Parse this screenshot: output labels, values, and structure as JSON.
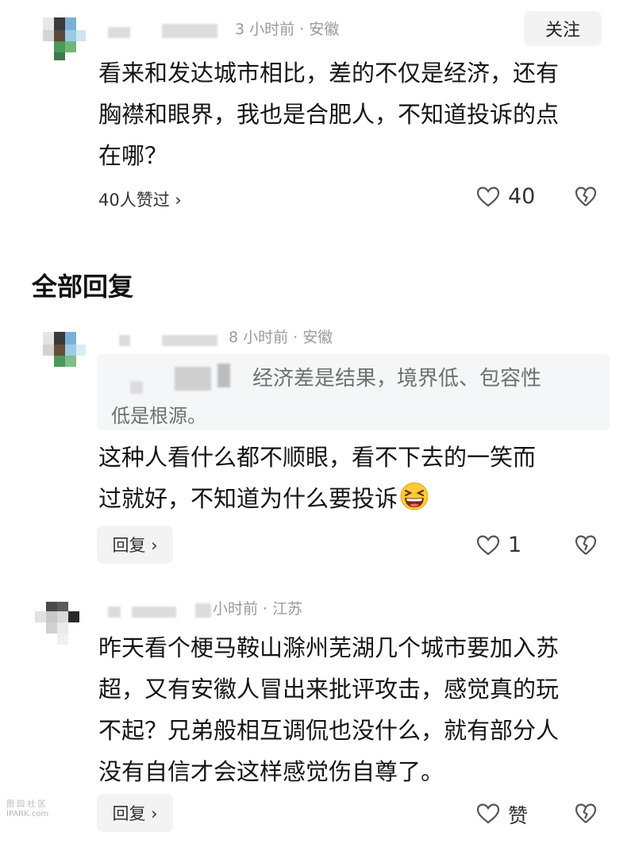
{
  "comment": {
    "meta": "3 小时前 · 安徽",
    "follow_label": "关注",
    "lines": [
      "看来和发达城市相比，差的不仅是经济，还有",
      "胸襟和眼界，我也是合肥人，不知道投诉的点",
      "在哪？"
    ],
    "likers": "40人赞过 ›",
    "like_count": "40"
  },
  "section_title": "全部回复",
  "replies": [
    {
      "meta": "8 小时前 · 安徽",
      "quote_line1": "经济差是结果，境界低、包容性",
      "quote_line2": "低是根源。",
      "lines": [
        "这种人看什么都不顺眼，看不下去的一笑而",
        "过就好，不知道为什么要投诉"
      ],
      "emoji": "grinning-squinting-face",
      "reply_label": "回复 ›",
      "like_count": "1"
    },
    {
      "meta": "小时前 · 江苏",
      "lines": [
        "昨天看个梗马鞍山滁州芜湖几个城市要加入苏",
        "超，又有安徽人冒出来批评攻击，感觉真的玩",
        "不起？兄弟般相互调侃也没什么，就有部分人",
        "没有自信才会这样感觉伤自尊了。"
      ],
      "reply_label": "回复 ›",
      "like_label": "赞"
    }
  ],
  "watermark": [
    "图 园 社 区",
    "IPARK.com"
  ],
  "colors": {
    "text": "#151515",
    "meta": "#9a9a9a",
    "button_bg": "#f3f3f3",
    "quote_bg": "#f4f6f8"
  }
}
